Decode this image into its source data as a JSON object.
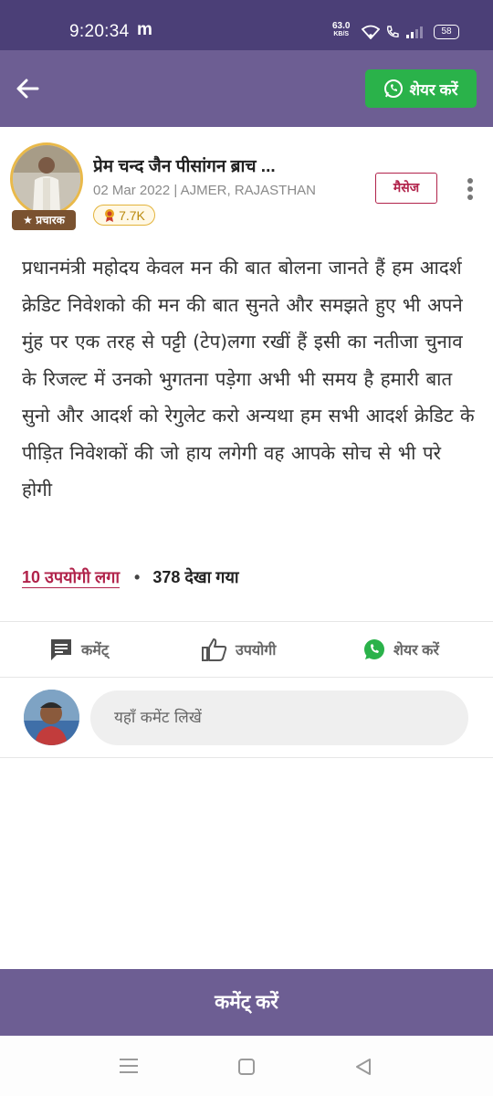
{
  "status_bar": {
    "time": "9:20:34",
    "app_icon_label": "m",
    "net_speed": "63.0",
    "net_unit": "KB/S",
    "battery": "58",
    "icons": [
      "wifi-icon",
      "call-icon",
      "signal-icon"
    ]
  },
  "app_bar": {
    "back_icon": "arrow-left-icon",
    "share_label": "शेयर करें",
    "share_color": "#2ab24a"
  },
  "post": {
    "author": "प्रेम चन्द जैन पीसांगन ब्राच ...",
    "author_badge": "★ प्रचारक",
    "date": "02 Mar 2022",
    "location": "AJMER, RAJASTHAN",
    "points": "7.7K",
    "message_label": "मैसेज",
    "body": "प्रधानमंत्री महोदय केवल मन की बात बोलना जानते हैं हम आदर्श क्रेडिट निवेशको की मन की बात सुनते और समझते हुए भी अपने मुंह पर एक तरह से पट्टी (टेप)लगा रखीं हैं इसी का नतीजा चुनाव के रिजल्ट में उनको भुगतना पड़ेगा अभी भी समय है हमारी बात सुनो और आदर्श को रेगुलेट करो अन्यथा हम सभी आदर्श क्रेडिट के पीड़ित निवेशकों की जो हाय लगेगी वह आपके सोच से भी परे होगी",
    "useful_count_label": "10 उपयोगी लगा",
    "separator": "•",
    "views_label": "378 देखा गया"
  },
  "actions": {
    "comment_label": "कमेंट्",
    "useful_label": "उपयोगी",
    "share_label": "शेयर करें"
  },
  "comment_box": {
    "placeholder": "यहाँ कमेंट लिखें"
  },
  "bottom_cta": {
    "label": "कमेंट् करें"
  },
  "colors": {
    "app_bar": "#6d5e93",
    "status_bar": "#4b3f77",
    "accent_red": "#b1234b",
    "whatsapp_green": "#2ab24a"
  }
}
